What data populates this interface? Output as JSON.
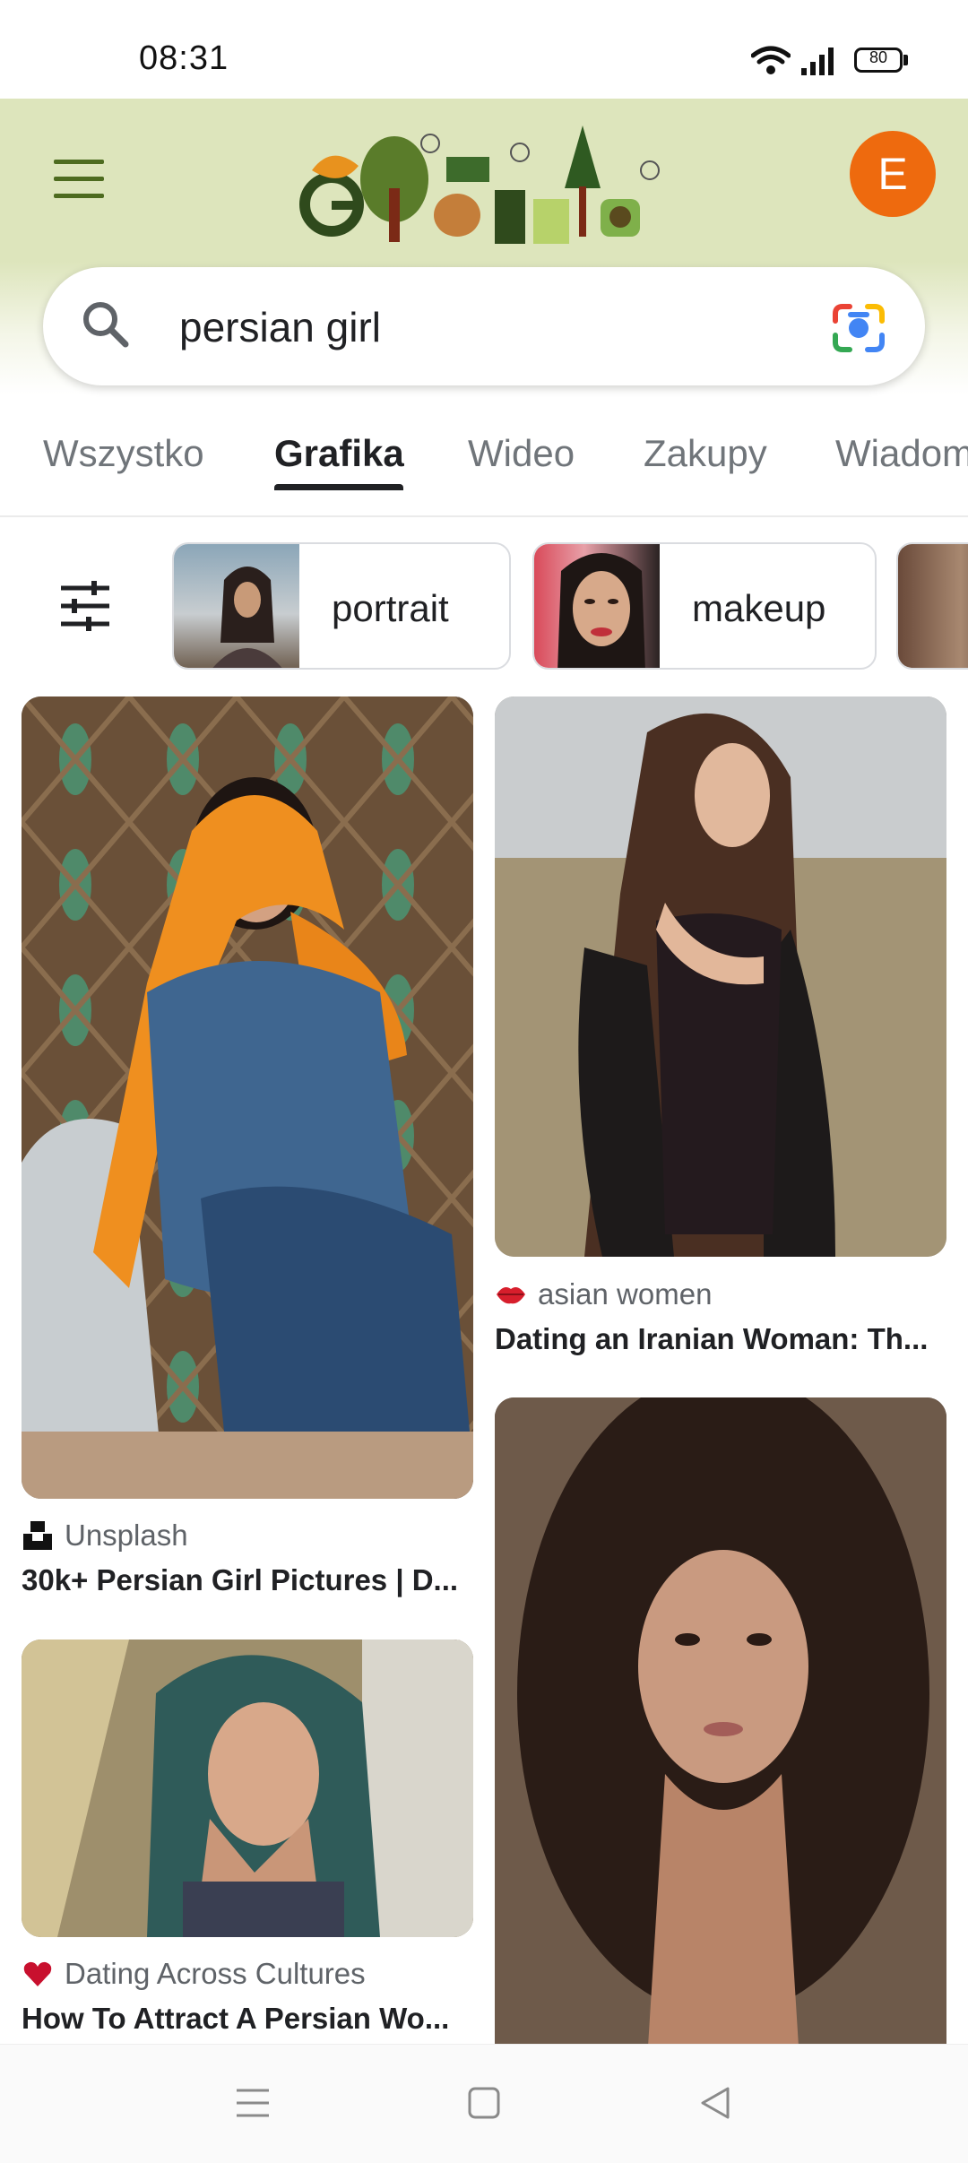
{
  "status_bar": {
    "time": "08:31",
    "battery": "80",
    "icons": [
      "wifi-icon",
      "signal-icon",
      "battery-icon"
    ]
  },
  "header": {
    "menu_icon": "hamburger-menu-icon",
    "logo": "google-doodle-logo",
    "avatar_letter": "E",
    "avatar_color": "#ee6a0e"
  },
  "search": {
    "query": "persian girl",
    "icons": [
      "search-icon",
      "google-lens-icon"
    ]
  },
  "tabs": [
    {
      "label": "Wszystko",
      "active": false
    },
    {
      "label": "Grafika",
      "active": true
    },
    {
      "label": "Wideo",
      "active": false
    },
    {
      "label": "Zakupy",
      "active": false
    },
    {
      "label": "Wiadomości",
      "active": false
    }
  ],
  "chips": [
    {
      "label": "portrait"
    },
    {
      "label": "makeup"
    }
  ],
  "results": [
    {
      "source": "Unsplash",
      "title": "30k+ Persian Girl Pictures | D..."
    },
    {
      "source": "asian women",
      "title": "Dating an Iranian Woman: Th..."
    },
    {
      "source": "Dating Across Cultures",
      "title": "How To Attract A Persian Wo..."
    },
    {
      "source": "",
      "title": ""
    }
  ],
  "nav_bar": {
    "icons": [
      "recent-apps-icon",
      "home-icon",
      "back-icon"
    ]
  }
}
